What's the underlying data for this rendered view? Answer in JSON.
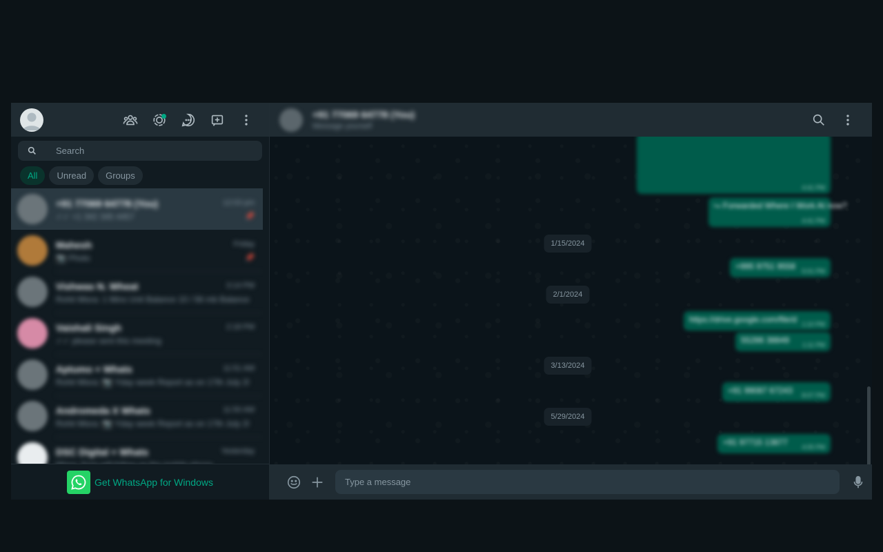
{
  "sidebar": {
    "search": {
      "placeholder": "Search"
    },
    "filters": [
      "All",
      "Unread",
      "Groups"
    ],
    "chats": [
      {
        "name": "+91 77069 64778 (You)",
        "time": "12:03 pm",
        "preview": "✓✓ +1 342 345 4457",
        "pinned": true,
        "avatar_color": "#6b757a"
      },
      {
        "name": "Mahesh",
        "time": "Friday",
        "preview": "📷 Photo",
        "pinned": true,
        "avatar_color": "#b07a3a"
      },
      {
        "name": "Vishwas N. Wheat",
        "time": "3:14 PM",
        "preview": "Rohit Misra: 1 Mins Unit Balance 10 / 56 mb Balance",
        "pinned": false,
        "avatar_color": "#6b757a"
      },
      {
        "name": "Vaishali Singh",
        "time": "2:18 PM",
        "preview": "✓✓ please sent this meeting",
        "pinned": false,
        "avatar_color": "#d68aa6"
      },
      {
        "name": "Aptumo + Whats",
        "time": "11:51 AM",
        "preview": "Rohit Misra: 📷 Yday week Report as on 17th July 2024",
        "pinned": false,
        "avatar_color": "#6b757a"
      },
      {
        "name": "Andromeda X Whats",
        "time": "11:50 AM",
        "preview": "Rohit Misra: 📷 Yday week Report as on 17th July 2024",
        "pinned": false,
        "avatar_color": "#6b757a"
      },
      {
        "name": "DSC Digital + Whats",
        "time": "Yesterday",
        "preview": "Misra: Sure will follow up the mobile phone",
        "pinned": false,
        "avatar_color": "#e9edef"
      }
    ],
    "footer_link": "Get WhatsApp for Windows"
  },
  "conversation": {
    "title": "+91 77069 64778 (You)",
    "subtitle": "Message yourself",
    "composer_placeholder": "Type a message",
    "dates": [
      "1/15/2024",
      "2/1/2024",
      "3/13/2024",
      "5/29/2024"
    ],
    "messages": [
      {
        "text": "",
        "meta": "4:41 PM"
      },
      {
        "text": "⮡ Forwarded\nWhere I Work At now?",
        "meta": "4:41 PM"
      },
      {
        "text": "+995 9751 9558",
        "meta": "5:01 PM"
      },
      {
        "text": "https://drive.google.com/file/d",
        "meta": "1:10 PM"
      },
      {
        "text": "55286 38849",
        "meta": "1:11 PM"
      },
      {
        "text": "+91 99087 67243",
        "meta": "8:07 PM"
      },
      {
        "text": "+91 97715 13877",
        "meta": "4:05 PM"
      }
    ]
  },
  "colors": {
    "accent": "#00a884",
    "outgoing_bubble": "#005c4b",
    "panel": "#202c33",
    "background": "#111b21"
  }
}
